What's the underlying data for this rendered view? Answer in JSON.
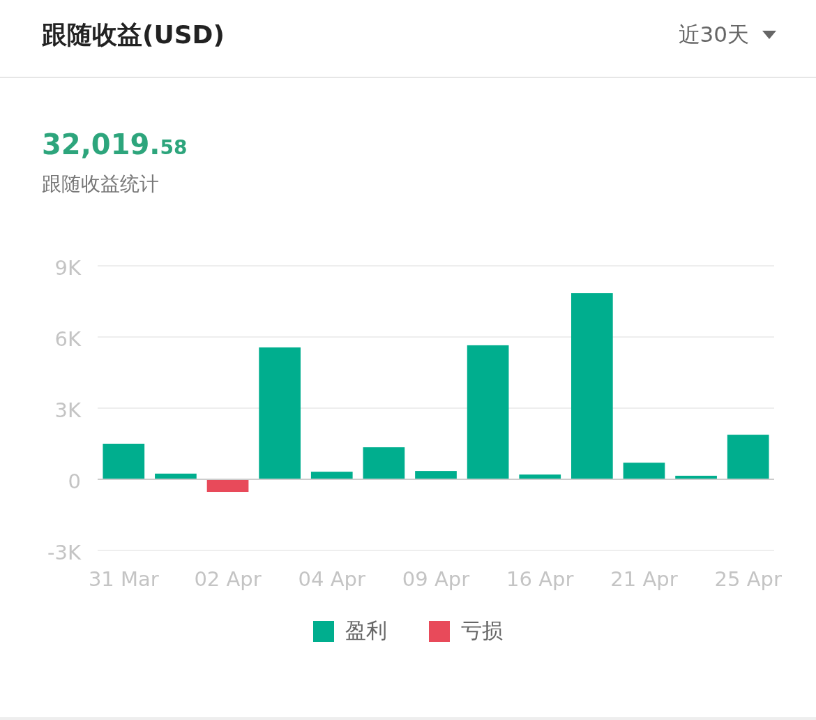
{
  "header": {
    "title": "跟随收益(USD)",
    "period_dropdown": {
      "value": "近30天"
    }
  },
  "summary": {
    "amount_integer": "32,019.",
    "amount_decimal": "58",
    "label": "跟随收益统计"
  },
  "chart_data": {
    "type": "bar",
    "stacked": true,
    "categories": [
      "31 Mar",
      null,
      "02 Apr",
      null,
      "04 Apr",
      null,
      "09 Apr",
      null,
      "16 Apr",
      null,
      "21 Apr",
      null,
      "25 Apr"
    ],
    "ylim": [
      -3000,
      9000
    ],
    "yticks": [
      {
        "value": -3000,
        "label": "-3K"
      },
      {
        "value": 0,
        "label": "0"
      },
      {
        "value": 3000,
        "label": "3K"
      },
      {
        "value": 6000,
        "label": "6K"
      },
      {
        "value": 9000,
        "label": "9K"
      }
    ],
    "series": [
      {
        "name": "盈利",
        "color": "#00ae8e",
        "values": [
          1500,
          240,
          null,
          5560,
          320,
          1350,
          350,
          5650,
          200,
          7850,
          700,
          150,
          1880
        ]
      },
      {
        "name": "亏损",
        "color": "#e84a5a",
        "values": [
          null,
          null,
          -530,
          null,
          null,
          null,
          null,
          null,
          null,
          null,
          null,
          null,
          null
        ]
      }
    ]
  }
}
